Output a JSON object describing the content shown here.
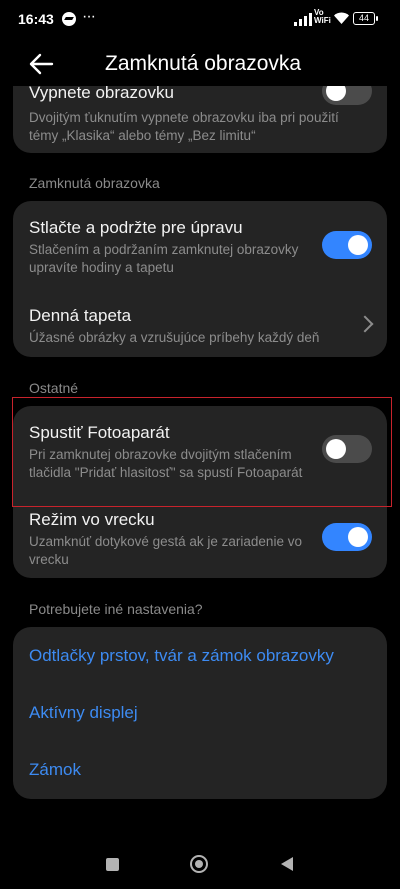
{
  "status_bar": {
    "time": "16:43",
    "more": "···",
    "network_label_top": "Vo",
    "network_label_bottom": "WiFi",
    "battery": "44"
  },
  "header": {
    "title": "Zamknutá obrazovka",
    "back_icon": "arrow-left-icon"
  },
  "top_card": {
    "title": "Vypnete obrazovku",
    "subtitle": "Dvojitým ťuknutím vypnete obrazovku iba pri použití témy „Klasika“ alebo témy „Bez limitu“",
    "toggle_on": false
  },
  "section_lock": {
    "label": "Zamknutá obrazovka",
    "items": [
      {
        "title": "Stlačte a podržte pre úpravu",
        "subtitle": "Stlačením a podržaním zamknutej obrazovky upravíte hodiny a tapetu",
        "toggle_on": true
      },
      {
        "title": "Denná tapeta",
        "subtitle": "Úžasné obrázky a vzrušujúce príbehy každý deň",
        "icon": "chevron-right-icon"
      }
    ]
  },
  "section_other": {
    "label": "Ostatné",
    "items": [
      {
        "title": "Spustiť Fotoaparát",
        "subtitle": "Pri zamknutej obrazovke dvojitým stlačením tlačidla \"Pridať hlasitosť\" sa spustí Fotoaparát",
        "toggle_on": false
      },
      {
        "title": "Režim vo vrecku",
        "subtitle": "Uzamknúť dotykové gestá ak je zariadenie vo vrecku",
        "toggle_on": true
      }
    ]
  },
  "section_more": {
    "label": "Potrebujete iné nastavenia?",
    "links": [
      "Odtlačky prstov, tvár a zámok obrazovky",
      "Aktívny displej",
      "Zámok"
    ]
  },
  "colors": {
    "accent": "#3385ff",
    "link": "#3d8bf2",
    "card": "#242424",
    "background": "#000000",
    "highlight_border": "#c8232c"
  }
}
